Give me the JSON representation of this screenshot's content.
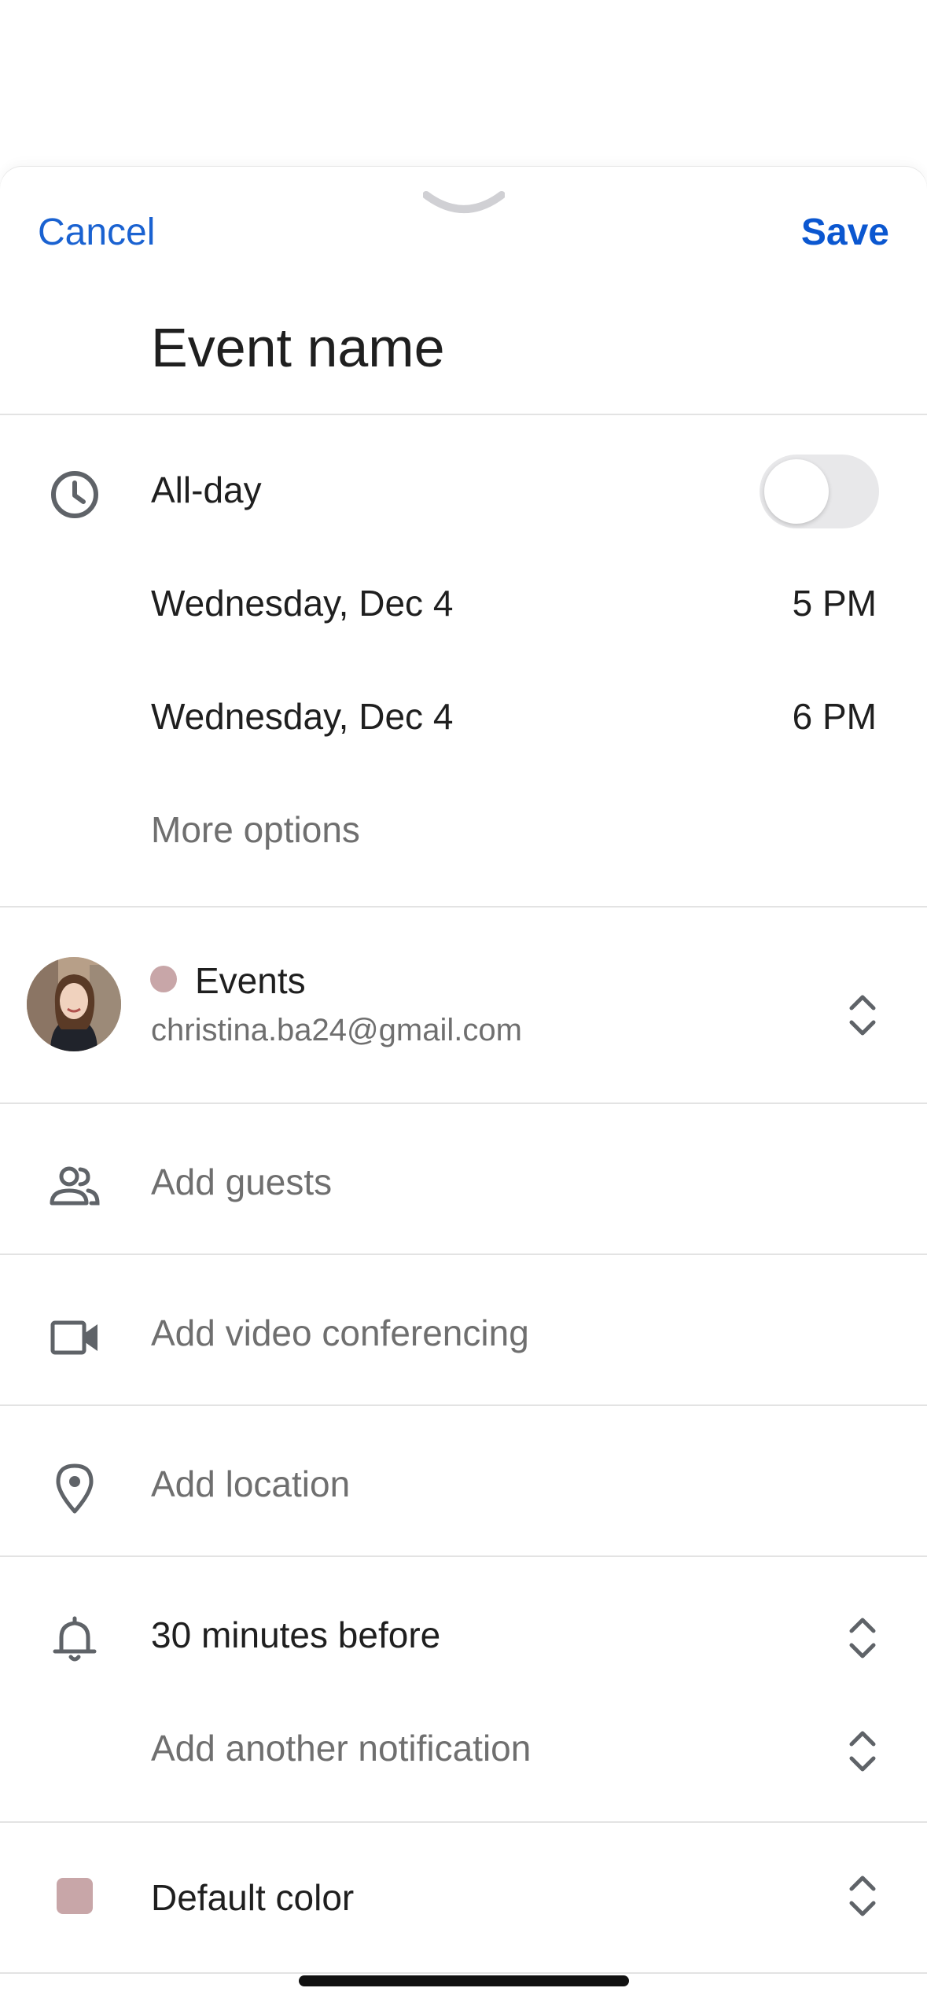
{
  "header": {
    "cancel_label": "Cancel",
    "save_label": "Save",
    "title": "Event name"
  },
  "time": {
    "all_day_label": "All-day",
    "all_day_on": false,
    "start_date": "Wednesday, Dec 4",
    "start_time": "5 PM",
    "end_date": "Wednesday, Dec 4",
    "end_time": "6 PM",
    "more_options": "More options"
  },
  "calendar": {
    "name": "Events",
    "email": "christina.ba24@gmail.com",
    "color": "#c8a6a8"
  },
  "rows": {
    "guests": "Add guests",
    "video": "Add video conferencing",
    "location": "Add location"
  },
  "notifications": {
    "first": "30 minutes before",
    "add_another": "Add another notification"
  },
  "color": {
    "label": "Default color",
    "swatch": "#c8a6a8"
  },
  "theme": {
    "accent": "#1a62d1",
    "divider": "#e3e3e3",
    "text": "#1f1f1f",
    "muted": "#6f6f6f"
  }
}
